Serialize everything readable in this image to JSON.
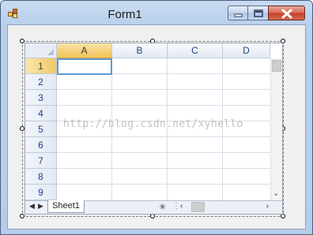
{
  "window": {
    "title": "Form1"
  },
  "spreadsheet": {
    "columns": [
      "A",
      "B",
      "C",
      "D"
    ],
    "rows": [
      "1",
      "2",
      "3",
      "4",
      "5",
      "6",
      "7",
      "8",
      "9"
    ],
    "active_cell": "A1",
    "sheet_tabs": [
      "Sheet1"
    ],
    "new_sheet_icon": "sparkle-icon"
  },
  "watermark": "http://blog.csdn.net/xyhello",
  "colors": {
    "active_header": "#f0c35a",
    "active_cell_border": "#5b9bd5",
    "header_text": "#24408a",
    "close_button": "#c5402a"
  }
}
